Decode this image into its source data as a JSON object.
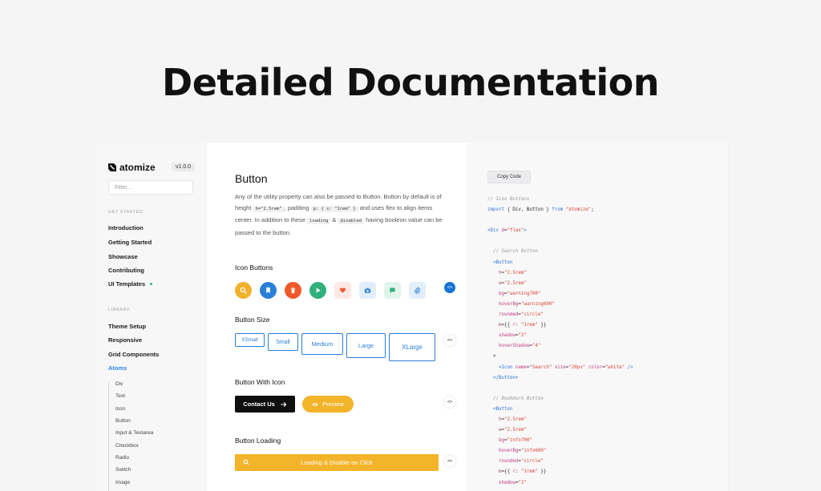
{
  "hero": {
    "title": "Detailed Documentation"
  },
  "sidebar": {
    "brand": "atomize",
    "version": "v1.0.0",
    "filter_placeholder": "Filter...",
    "get_started_label": "GET STARTED",
    "get_started_items": [
      "Introduction",
      "Getting Started",
      "Showcase",
      "Contributing",
      "UI Templates"
    ],
    "library_label": "LIBRARY",
    "library_items": [
      "Theme Setup",
      "Responsive",
      "Grid Components",
      "Atoms"
    ],
    "atoms_items": [
      "Div",
      "Text",
      "Icon",
      "Button",
      "Input & Textarea",
      "Checkbox",
      "Radio",
      "Switch",
      "Image"
    ]
  },
  "docs": {
    "title": "Button",
    "desc_1": "Any of the utility property can also be passed to Button. Button by default is of height",
    "chip_height": "h=\"2.5rem\"",
    "desc_2": ", padding",
    "chip_padding": "p: { x: \"1rem\" }",
    "desc_3": "and uses flex to align items center. In addition to these",
    "chip_loading": "loading",
    "desc_amp": "&",
    "chip_disabled": "disabled",
    "desc_4": "having booleon value can be passed to the button.",
    "toggle_label": "<>",
    "icon_buttons": {
      "title": "Icon Buttons",
      "buttons": [
        {
          "icon": "search-icon",
          "bg": "#f2b12a",
          "fg": "#ffffff"
        },
        {
          "icon": "bookmark-icon",
          "bg": "#2a7fd9",
          "fg": "#ffffff"
        },
        {
          "icon": "trash-icon",
          "bg": "#f0592b",
          "fg": "#ffffff"
        },
        {
          "icon": "play-icon",
          "bg": "#2fb07c",
          "fg": "#ffffff"
        },
        {
          "icon": "heart-icon",
          "bg": "#fde8e6",
          "fg": "#f0592b"
        },
        {
          "icon": "camera-icon",
          "bg": "#e3eefb",
          "fg": "#2a7fd9"
        },
        {
          "icon": "message-icon",
          "bg": "#e1f4ec",
          "fg": "#2fb07c"
        },
        {
          "icon": "attachment-icon",
          "bg": "#e3eefb",
          "fg": "#2a7fd9"
        }
      ]
    },
    "button_size": {
      "title": "Button Size",
      "buttons": [
        "XSmall",
        "Small",
        "Medium",
        "Large",
        "XLarge"
      ]
    },
    "button_with_icon": {
      "title": "Button With Icon",
      "contact": "Contact Us",
      "preview": "Preview"
    },
    "button_loading": {
      "title": "Button Loading",
      "label": "Loading & Disable on Click"
    }
  },
  "code_panel": {
    "copy_label": "Copy Code",
    "lines": [
      [
        [
          "c-com",
          "// Icon Buttons"
        ]
      ],
      [
        [
          "c-kw",
          "import"
        ],
        [
          "c-pun",
          " { Div, Button } "
        ],
        [
          "c-kw",
          "from"
        ],
        [
          "c-pun",
          " "
        ],
        [
          "c-str",
          "\"atomize\""
        ],
        [
          "c-pun",
          ";"
        ]
      ],
      [],
      [
        [
          "c-tag",
          "<Div"
        ],
        [
          "c-pun",
          " "
        ],
        [
          "c-attr",
          "d"
        ],
        [
          "c-pun",
          "="
        ],
        [
          "c-str",
          "\"flex\""
        ],
        [
          "c-tag",
          ">"
        ]
      ],
      [],
      [
        [
          "c-pun",
          "  "
        ],
        [
          "c-com",
          "// Search Button"
        ]
      ],
      [
        [
          "c-pun",
          "  "
        ],
        [
          "c-tag",
          "<Button"
        ]
      ],
      [
        [
          "c-pun",
          "    "
        ],
        [
          "c-attr",
          "h"
        ],
        [
          "c-pun",
          "="
        ],
        [
          "c-str",
          "\"2.5rem\""
        ]
      ],
      [
        [
          "c-pun",
          "    "
        ],
        [
          "c-attr",
          "w"
        ],
        [
          "c-pun",
          "="
        ],
        [
          "c-str",
          "\"2.5rem\""
        ]
      ],
      [
        [
          "c-pun",
          "    "
        ],
        [
          "c-attr",
          "bg"
        ],
        [
          "c-pun",
          "="
        ],
        [
          "c-str",
          "\"warning700\""
        ]
      ],
      [
        [
          "c-pun",
          "    "
        ],
        [
          "c-attr",
          "hoverBg"
        ],
        [
          "c-pun",
          "="
        ],
        [
          "c-str",
          "\"warning600\""
        ]
      ],
      [
        [
          "c-pun",
          "    "
        ],
        [
          "c-attr",
          "rounded"
        ],
        [
          "c-pun",
          "="
        ],
        [
          "c-str",
          "\"circle\""
        ]
      ],
      [
        [
          "c-pun",
          "    "
        ],
        [
          "c-attr",
          "m"
        ],
        [
          "c-pun",
          "={{ "
        ],
        [
          "c-attr",
          "r"
        ],
        [
          "c-pun",
          ": "
        ],
        [
          "c-str",
          "\"1rem\""
        ],
        [
          "c-pun",
          " }}"
        ]
      ],
      [
        [
          "c-pun",
          "    "
        ],
        [
          "c-attr",
          "shadow"
        ],
        [
          "c-pun",
          "="
        ],
        [
          "c-str",
          "\"2\""
        ]
      ],
      [
        [
          "c-pun",
          "    "
        ],
        [
          "c-attr",
          "hoverShadow"
        ],
        [
          "c-pun",
          "="
        ],
        [
          "c-str",
          "\"4\""
        ]
      ],
      [
        [
          "c-pun",
          "  >"
        ]
      ],
      [
        [
          "c-pun",
          "    "
        ],
        [
          "c-tag",
          "<Icon"
        ],
        [
          "c-pun",
          " "
        ],
        [
          "c-attr",
          "name"
        ],
        [
          "c-pun",
          "="
        ],
        [
          "c-str",
          "\"Search\""
        ],
        [
          "c-pun",
          " "
        ],
        [
          "c-attr",
          "size"
        ],
        [
          "c-pun",
          "="
        ],
        [
          "c-str",
          "\"20px\""
        ],
        [
          "c-pun",
          " "
        ],
        [
          "c-attr",
          "color"
        ],
        [
          "c-pun",
          "="
        ],
        [
          "c-str",
          "\"white\""
        ],
        [
          "c-pun",
          " "
        ],
        [
          "c-tag",
          "/>"
        ]
      ],
      [
        [
          "c-pun",
          "  "
        ],
        [
          "c-tag",
          "</Button>"
        ]
      ],
      [],
      [
        [
          "c-pun",
          "  "
        ],
        [
          "c-com",
          "// Bookmark Button"
        ]
      ],
      [
        [
          "c-pun",
          "  "
        ],
        [
          "c-tag",
          "<Button"
        ]
      ],
      [
        [
          "c-pun",
          "    "
        ],
        [
          "c-attr",
          "h"
        ],
        [
          "c-pun",
          "="
        ],
        [
          "c-str",
          "\"2.5rem\""
        ]
      ],
      [
        [
          "c-pun",
          "    "
        ],
        [
          "c-attr",
          "w"
        ],
        [
          "c-pun",
          "="
        ],
        [
          "c-str",
          "\"2.5rem\""
        ]
      ],
      [
        [
          "c-pun",
          "    "
        ],
        [
          "c-attr",
          "bg"
        ],
        [
          "c-pun",
          "="
        ],
        [
          "c-str",
          "\"info700\""
        ]
      ],
      [
        [
          "c-pun",
          "    "
        ],
        [
          "c-attr",
          "hoverBg"
        ],
        [
          "c-pun",
          "="
        ],
        [
          "c-str",
          "\"info600\""
        ]
      ],
      [
        [
          "c-pun",
          "    "
        ],
        [
          "c-attr",
          "rounded"
        ],
        [
          "c-pun",
          "="
        ],
        [
          "c-str",
          "\"circle\""
        ]
      ],
      [
        [
          "c-pun",
          "    "
        ],
        [
          "c-attr",
          "m"
        ],
        [
          "c-pun",
          "={{ "
        ],
        [
          "c-attr",
          "r"
        ],
        [
          "c-pun",
          ": "
        ],
        [
          "c-str",
          "\"1rem\""
        ],
        [
          "c-pun",
          " }}"
        ]
      ],
      [
        [
          "c-pun",
          "    "
        ],
        [
          "c-attr",
          "shadow"
        ],
        [
          "c-pun",
          "="
        ],
        [
          "c-str",
          "\"2\""
        ]
      ]
    ]
  },
  "colors": {
    "accent_blue": "#2a7fd9",
    "warning": "#f3b42a",
    "page_bg": "#f5f5f6"
  }
}
